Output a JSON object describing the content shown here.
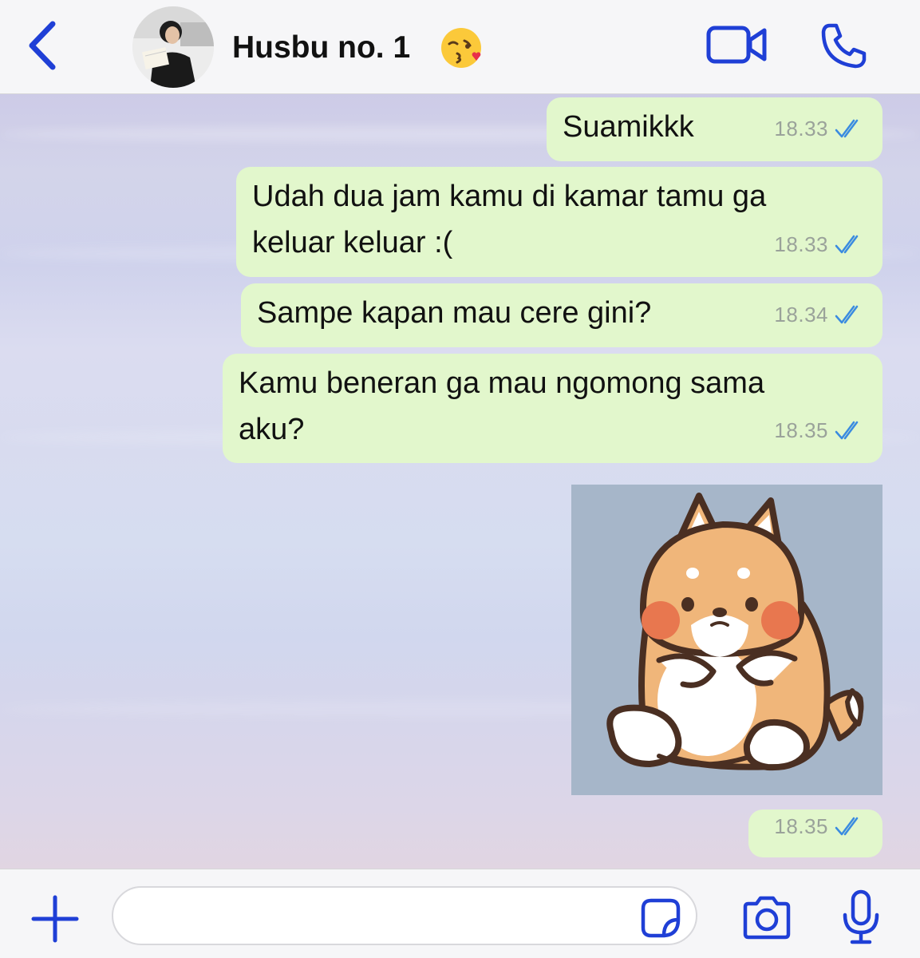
{
  "header": {
    "contact_name": "Husbu no. 1",
    "name_emoji": "face-blowing-kiss-emoji",
    "back_icon": "chevron-left-icon",
    "video_icon": "video-camera-icon",
    "call_icon": "phone-icon"
  },
  "messages": [
    {
      "text": "Suamikkk",
      "time": "18.33",
      "status": "read"
    },
    {
      "text": "Udah dua jam kamu di kamar tamu ga\nkeluar keluar :(",
      "time": "18.33",
      "status": "read"
    },
    {
      "text": "Sampe kapan mau cere gini?",
      "time": "18.34",
      "status": "read"
    },
    {
      "text": "Kamu beneran ga mau ngomong sama\naku?",
      "time": "18.35",
      "status": "read"
    },
    {
      "type": "sticker",
      "sticker": "shiba-dog-sticker",
      "time": "18.35",
      "status": "read"
    }
  ],
  "input": {
    "placeholder": "",
    "plus_icon": "plus-icon",
    "sticker_icon": "sticker-icon",
    "camera_icon": "camera-icon",
    "mic_icon": "microphone-icon"
  },
  "colors": {
    "accent": "#1f3fd6",
    "outgoing_bubble": "#e2f7cc",
    "read_ticks": "#3a8be0",
    "time_text": "#9aa29a",
    "sticker_bg": "#a6b6c9",
    "dog_fur": "#f0b67a"
  }
}
